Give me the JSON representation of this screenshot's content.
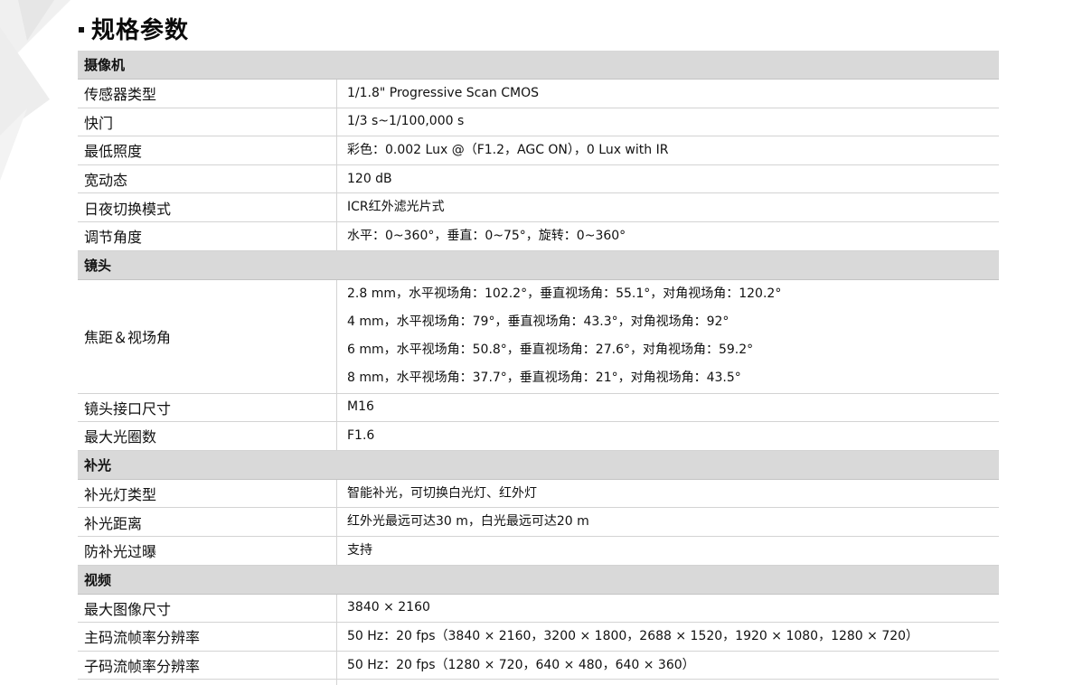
{
  "page": {
    "title": "规格参数"
  },
  "sections": [
    {
      "name": "摄像机",
      "rows": [
        {
          "label": "传感器类型",
          "values": [
            "1/1.8\" Progressive Scan CMOS"
          ]
        },
        {
          "label": "快门",
          "values": [
            "1/3 s~1/100,000 s"
          ]
        },
        {
          "label": "最低照度",
          "values": [
            "彩色：0.002 Lux @（F1.2，AGC ON），0 Lux with IR"
          ]
        },
        {
          "label": "宽动态",
          "values": [
            "120 dB"
          ]
        },
        {
          "label": "日夜切换模式",
          "values": [
            "ICR红外滤光片式"
          ]
        },
        {
          "label": "调节角度",
          "values": [
            "水平：0~360°，垂直：0~75°，旋转：0~360°"
          ]
        }
      ]
    },
    {
      "name": "镜头",
      "rows": [
        {
          "label": "焦距＆视场角",
          "values": [
            "2.8 mm，水平视场角：102.2°，垂直视场角：55.1°，对角视场角：120.2°",
            "4 mm，水平视场角：79°，垂直视场角：43.3°，对角视场角：92°",
            "6 mm，水平视场角：50.8°，垂直视场角：27.6°，对角视场角：59.2°",
            "8 mm，水平视场角：37.7°，垂直视场角：21°，对角视场角：43.5°"
          ]
        },
        {
          "label": "镜头接口尺寸",
          "values": [
            "M16"
          ]
        },
        {
          "label": "最大光圈数",
          "values": [
            "F1.6"
          ]
        }
      ]
    },
    {
      "name": "补光",
      "rows": [
        {
          "label": "补光灯类型",
          "values": [
            "智能补光，可切换白光灯、红外灯"
          ]
        },
        {
          "label": "补光距离",
          "values": [
            "红外光最远可达30 m，白光最远可达20 m"
          ]
        },
        {
          "label": "防补光过曝",
          "values": [
            "支持"
          ]
        }
      ]
    },
    {
      "name": "视频",
      "rows": [
        {
          "label": "最大图像尺寸",
          "values": [
            "3840 × 2160"
          ]
        },
        {
          "label": "主码流帧率分辨率",
          "values": [
            "50 Hz：20 fps（3840 × 2160，3200 × 1800，2688 × 1520，1920 × 1080，1280 × 720）"
          ]
        },
        {
          "label": "子码流帧率分辨率",
          "values": [
            "50 Hz：20 fps（1280 × 720，640 × 480，640 × 360）"
          ]
        }
      ]
    }
  ]
}
